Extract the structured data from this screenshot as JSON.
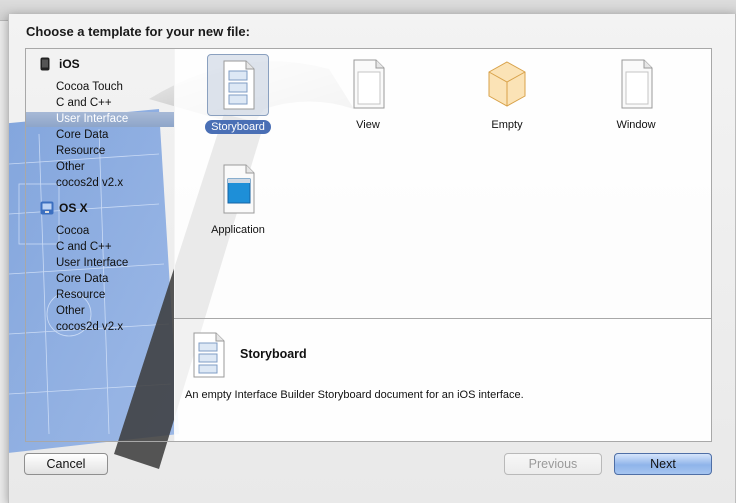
{
  "dialog": {
    "heading": "Choose a template for your new file:"
  },
  "sidebar": {
    "ios": {
      "header": "iOS",
      "items": [
        "Cocoa Touch",
        "C and C++",
        "User Interface",
        "Core Data",
        "Resource",
        "Other",
        "cocos2d v2.x"
      ],
      "selected_index": 2
    },
    "osx": {
      "header": "OS X",
      "items": [
        "Cocoa",
        "C and C++",
        "User Interface",
        "Core Data",
        "Resource",
        "Other",
        "cocos2d v2.x"
      ]
    }
  },
  "templates": {
    "items": [
      {
        "label": "Storyboard",
        "icon": "storyboard-doc-icon",
        "selected": true
      },
      {
        "label": "View",
        "icon": "view-doc-icon",
        "selected": false
      },
      {
        "label": "Empty",
        "icon": "empty-doc-icon",
        "selected": false
      },
      {
        "label": "Window",
        "icon": "window-doc-icon",
        "selected": false
      },
      {
        "label": "Application",
        "icon": "application-doc-icon",
        "selected": false
      }
    ]
  },
  "description": {
    "title": "Storyboard",
    "text": "An empty Interface Builder Storyboard document for an iOS interface."
  },
  "buttons": {
    "cancel": "Cancel",
    "previous": "Previous",
    "next": "Next"
  },
  "colors": {
    "selection": "#8ea5c9",
    "blueprint": "#7fa7e0",
    "primary_button": "#8fb4ea"
  }
}
